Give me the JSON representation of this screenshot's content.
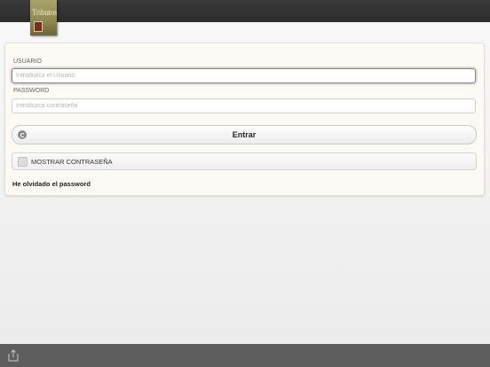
{
  "logo": {
    "text": "Tributos"
  },
  "login": {
    "username_label": "USUARIO",
    "username_placeholder": "Introduzca el Usuario",
    "username_value": "",
    "password_label": "PASSWORD",
    "password_placeholder": "Introduzca contraseña",
    "password_value": "",
    "submit_label": "Entrar",
    "show_password_label": "MOSTRAR CONTRASEÑA",
    "show_password_checked": false,
    "forgot_label": "He olvidado el password"
  },
  "icons": {
    "submit": "refresh-icon",
    "share": "share-icon"
  }
}
